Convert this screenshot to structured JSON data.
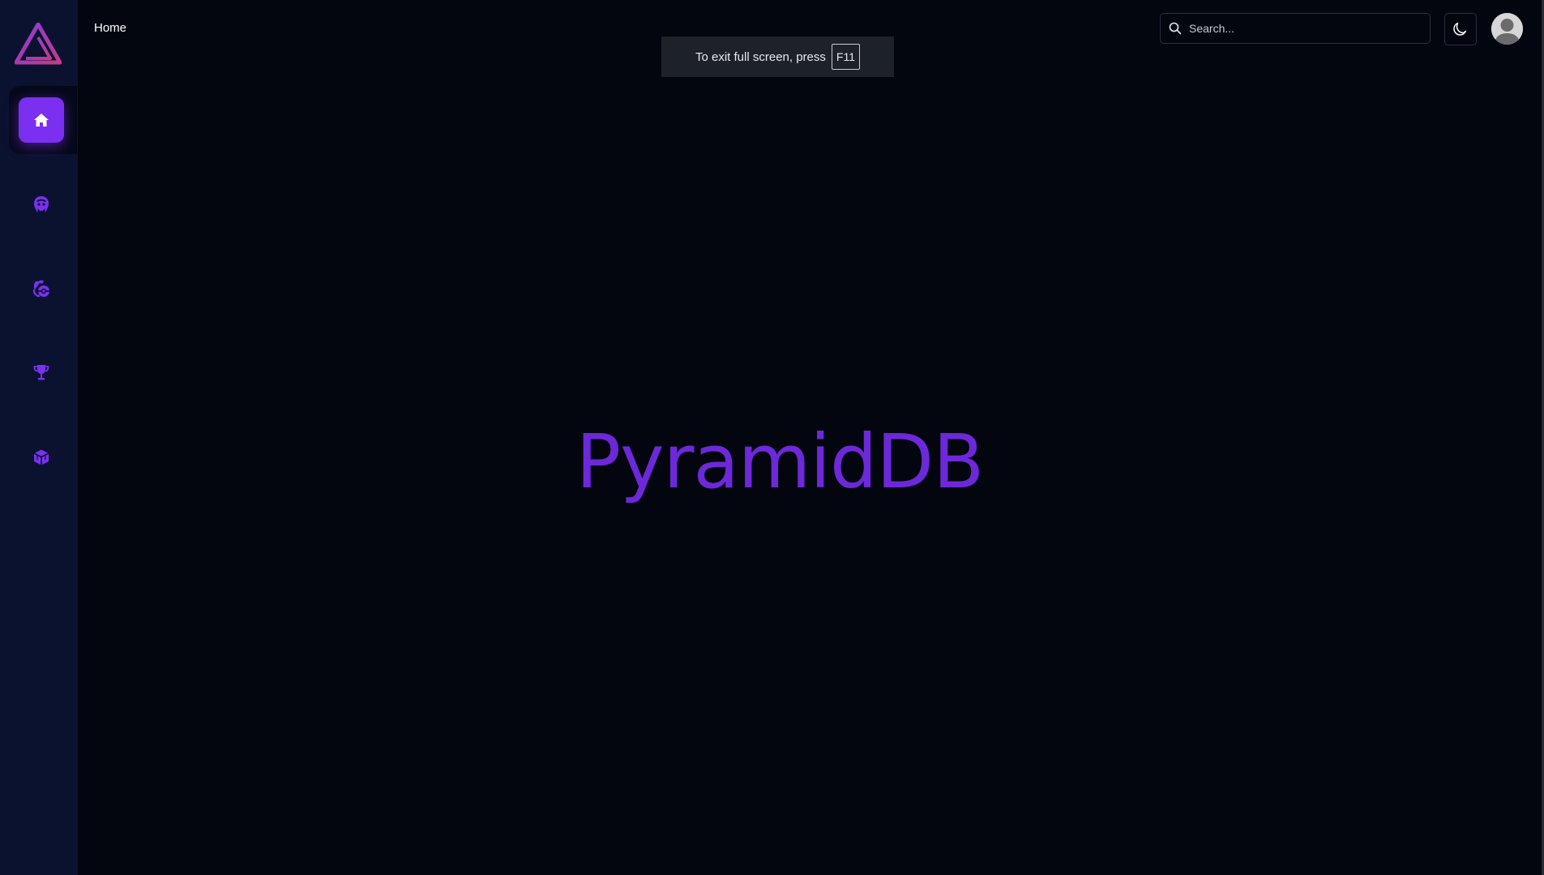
{
  "header": {
    "breadcrumb": "Home",
    "search": {
      "placeholder": "Search..."
    },
    "theme_icon": "moon-icon",
    "avatar_icon": "user-avatar-icon"
  },
  "sidebar": {
    "logo_icon": "pyramid-logo-icon",
    "items": [
      {
        "icon": "home-icon",
        "active": true
      },
      {
        "icon": "anime-character-icon",
        "active": false
      },
      {
        "icon": "pokeball-hand-icon",
        "active": false
      },
      {
        "icon": "trophy-icon",
        "active": false
      },
      {
        "icon": "cube-icon",
        "active": false
      }
    ]
  },
  "fullscreen_notice": {
    "text": "To exit full screen, press",
    "key": "F11"
  },
  "main": {
    "title": "PyramidDB"
  },
  "colors": {
    "accent": "#7b2ff0",
    "title": "#6d28d9",
    "background": "#03060f",
    "sidebar": "#0b1230"
  }
}
